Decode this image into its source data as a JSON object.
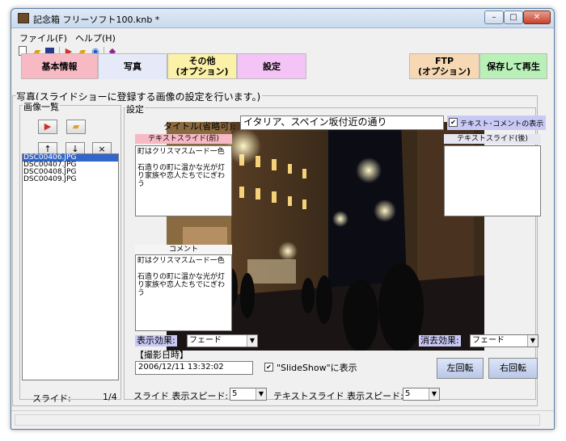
{
  "window": {
    "title": "記念箱 フリーソフト100.knb *",
    "min": "–",
    "max": "□",
    "close": "✕"
  },
  "menu": {
    "file": "ファイル(F)",
    "help": "ヘルプ(H)"
  },
  "toolbar": {
    "icons": [
      "new-file-icon",
      "open-folder-icon",
      "save-icon",
      "import-icon",
      "folder-icon",
      "find-icon",
      "book-icon"
    ]
  },
  "tabs": {
    "basic": "基本情報",
    "photo": "写真",
    "other_line1": "その他",
    "other_line2": "(オプション)",
    "settings": "設定",
    "ftp_line1": "FTP",
    "ftp_line2": "(オプション)",
    "save_play": "保存して再生"
  },
  "colors": {
    "tab_basic": "#f7b9c4",
    "tab_photo": "#e6e9f7",
    "tab_other": "#fbf1a8",
    "tab_settings": "#f3c4f5",
    "tab_ftp": "#f7d8b4",
    "tab_save": "#b8f0b8"
  },
  "panel": {
    "title": "写真(スライドショーに登録する画像の設定を行います。)",
    "list_title": "画像一覧",
    "settings_title": "設定"
  },
  "list_buttons": {
    "up": "↑",
    "down": "↓",
    "delete": "×"
  },
  "images": [
    "DSC00406.JPG",
    "DSC00407.JPG",
    "DSC00408.JPG",
    "DSC00409.JPG"
  ],
  "selected_index": 0,
  "slide_counter": {
    "label": "スライド:",
    "value": "1/4"
  },
  "title_field": {
    "label": "タイトル(省略可):",
    "value": "イタリア、スペイン坂付近の通り"
  },
  "text_comment_checkbox": {
    "label": "テキスト･コメントの表示",
    "checked": "✔"
  },
  "text_slide_before": {
    "label": "テキストスライド(前)",
    "value": "町はクリスマスムード一色\n\n石造りの町に温かな光が灯り家族や恋人たちでにぎわう"
  },
  "text_slide_after": {
    "label": "テキストスライド(後)",
    "value": ""
  },
  "comment": {
    "label": "コメント",
    "value": "町はクリスマスムード一色\n\n石造りの町に温かな光が灯り家族や恋人たちでにぎわう"
  },
  "display_effect": {
    "label": "表示効果:",
    "value": "フェード"
  },
  "erase_effect": {
    "label": "消去効果:",
    "value": "フェード"
  },
  "shot_date": {
    "label": "【撮影日時】",
    "value": "2006/12/11 13:32:02"
  },
  "slideshow_checkbox": {
    "label": "\"SlideShow\"に表示",
    "checked": "✔"
  },
  "rotate": {
    "left": "左回転",
    "right": "右回転"
  },
  "speed": {
    "slide_label": "スライド 表示スピード:",
    "slide_value": "5",
    "text_label": "テキストスライド 表示スピード:",
    "text_value": "5"
  }
}
